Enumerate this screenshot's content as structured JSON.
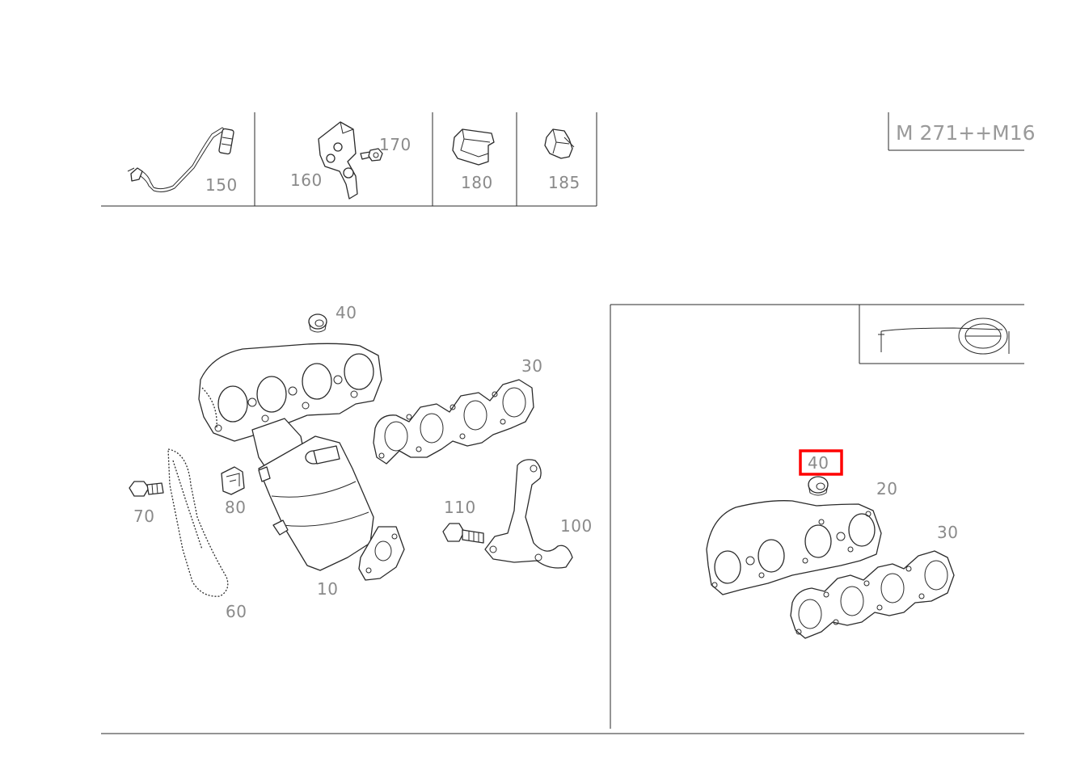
{
  "diagram_ref": "M 271++M16",
  "callouts": {
    "c150": "150",
    "c160": "160",
    "c170": "170",
    "c180": "180",
    "c185": "185",
    "c40a": "40",
    "c30a": "30",
    "c70": "70",
    "c80": "80",
    "c10": "10",
    "c60": "60",
    "c110": "110",
    "c100": "100",
    "c40b": "40",
    "c20": "20",
    "c30b": "30"
  },
  "highlighted_callout": "40",
  "highlight_color": "#ff0000"
}
